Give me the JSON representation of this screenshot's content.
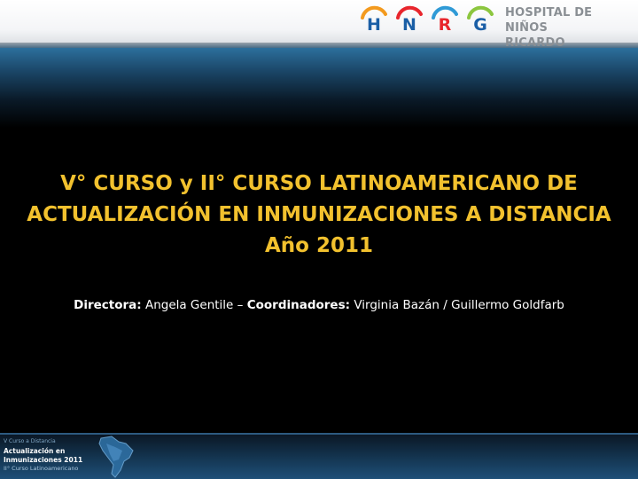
{
  "header": {
    "logo_letters": [
      {
        "letter": "H",
        "color": "#1b5fa6",
        "arc_color": "#f39a1e"
      },
      {
        "letter": "N",
        "color": "#1b5fa6",
        "arc_color": "#e8262d"
      },
      {
        "letter": "R",
        "color": "#e8262d",
        "arc_color": "#2f9ad6"
      },
      {
        "letter": "G",
        "color": "#1b5fa6",
        "arc_color": "#8cc63f"
      }
    ],
    "hospital_line1": "HOSPITAL DE NIÑOS",
    "hospital_line2": "RICARDO GUTIÉRREZ"
  },
  "slide": {
    "title_line1": "V° CURSO y II° CURSO LATINOAMERICANO DE",
    "title_line2": "ACTUALIZACIÓN EN INMUNIZACIONES A DISTANCIA",
    "title_line3": "Año 2011",
    "director_label": "Directora:",
    "director_name": "Angela Gentile",
    "separator": "–",
    "coordinators_label": "Coordinadores:",
    "coordinators_names": "Virginia Bazán / Guillermo Goldfarb"
  },
  "footer": {
    "course_line1": "V Curso a Distancia",
    "course_line2": "Actualización en Inmunizaciones 2011",
    "course_line3": "II° Curso Latinoamericano"
  },
  "colors": {
    "title": "#f2c12e",
    "hospital_text": "#8a8f94",
    "background": "#000000"
  }
}
